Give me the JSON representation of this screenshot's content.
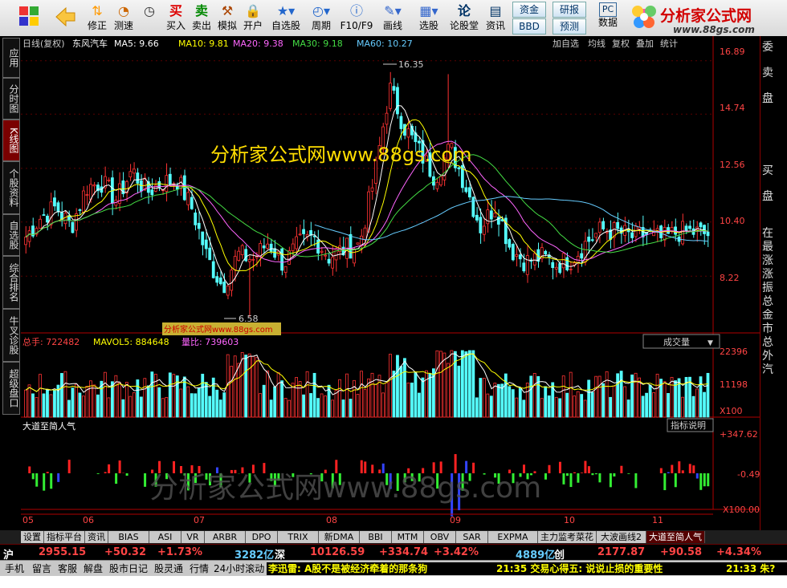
{
  "toolbar": {
    "buttons": [
      {
        "id": "fix",
        "label": "修正",
        "icon": "arrow-updown-icon"
      },
      {
        "id": "test",
        "label": "测速",
        "icon": "clock-icon"
      },
      {
        "id": "buy",
        "label": "买入",
        "icon": "buy-icon"
      },
      {
        "id": "sell",
        "label": "卖出",
        "icon": "sell-icon"
      },
      {
        "id": "sim",
        "label": "模拟",
        "icon": "hammer-icon"
      },
      {
        "id": "open",
        "label": "开户",
        "icon": "lock-icon"
      },
      {
        "id": "fav",
        "label": "自选股",
        "icon": "star-icon"
      },
      {
        "id": "period",
        "label": "周期",
        "icon": "clock-dropdown-icon"
      },
      {
        "id": "f10",
        "label": "F10/F9",
        "icon": "info-icon"
      },
      {
        "id": "draw",
        "label": "画线",
        "icon": "pen-icon"
      },
      {
        "id": "select",
        "label": "选股",
        "icon": "select-icon"
      },
      {
        "id": "forum",
        "label": "论股堂",
        "icon": "forum-icon"
      },
      {
        "id": "news",
        "label": "资讯",
        "icon": "news-icon"
      },
      {
        "id": "data",
        "label": "数据",
        "icon": "pc-icon"
      }
    ],
    "small": {
      "icon_a": "资",
      "icon_b": "研",
      "icon_c": "PC",
      "fund": "资金",
      "bbd": "BBD",
      "research": "研报",
      "forecast": "预测"
    },
    "logo": {
      "title": "分析家公式网",
      "url": "www.88gs.com"
    }
  },
  "leftnav": [
    "应用",
    "分时图",
    "K线图",
    "个股资料",
    "自选股",
    "综合排名",
    "牛叉诊股",
    "超级盘口"
  ],
  "main": {
    "period": "日线(复权)",
    "stock": "东风汽车",
    "ma": [
      {
        "label": "MA5: 9.66",
        "color": "#ffffff"
      },
      {
        "label": "MA10: 9.81",
        "color": "#ffff00"
      },
      {
        "label": "MA20: 9.38",
        "color": "#ff66ff"
      },
      {
        "label": "MA30: 9.18",
        "color": "#44dd44"
      },
      {
        "label": "MA60: 10.27",
        "color": "#66ccff"
      }
    ],
    "buttons": [
      "加自选",
      "均线",
      "复权",
      "叠加",
      "统计"
    ],
    "yticks": [
      "16.89",
      "14.74",
      "12.56",
      "10.40",
      "8.22"
    ],
    "high": "16.35",
    "low": "6.58",
    "watermark": "分析家公式网www.88gs.com",
    "watermark_small": "分析家公式网www.88gs.com"
  },
  "volume": {
    "total": "总手: 722482",
    "mavol": "MAVOL5: 884648",
    "ratio": "量比: 739603",
    "selector": "成交量",
    "yticks": [
      "22396",
      "11198",
      "X100"
    ]
  },
  "indicator": {
    "title": "大道至简人气",
    "button": "指标说明",
    "yticks": [
      "+347.62",
      "-0.49",
      "X100.00"
    ]
  },
  "xlabels": [
    "05",
    "06",
    "07",
    "08",
    "09",
    "10",
    "11"
  ],
  "bottom_watermark": "分析家公式网www.88gs.com",
  "right": [
    "委",
    "卖",
    "盘",
    "买",
    "盘",
    "在",
    "最",
    "涨",
    "涨",
    "振",
    "总",
    "金",
    "市",
    "总",
    "外",
    "汽"
  ],
  "tabs": [
    "设置",
    "指标平台",
    "资讯",
    "BIAS",
    "ASI",
    "VR",
    "ARBR",
    "DPO",
    "TRIX",
    "新DMA",
    "BBI",
    "MTM",
    "OBV",
    "SAR",
    "EXPMA",
    "主力监考菜花",
    "大波画线2",
    "大道至简人气"
  ],
  "quotes": [
    {
      "name": "沪",
      "value": "2955.15",
      "change": "+50.32",
      "pct": "+1.73%",
      "amount": "3282亿"
    },
    {
      "name": "深",
      "value": "10126.59",
      "change": "+334.74",
      "pct": "+3.42%",
      "amount": "4889亿"
    },
    {
      "name": "创",
      "value": "2177.87",
      "change": "+90.58",
      "pct": "+4.34%"
    }
  ],
  "status": {
    "items": [
      "手机",
      "留言",
      "客服",
      "解盘",
      "股市日记",
      "股灵通",
      "行情",
      "24小时滚动"
    ],
    "news1": "李迅雷: A股不是被经济牵着的那条狗",
    "news2": "21:35 交易心得五: 说说止损的重要性",
    "news3": "21:33 朱?"
  },
  "colors": {
    "up": "#ff3333",
    "down": "#55ffff",
    "axis": "#b00000"
  },
  "chart_data": {
    "type": "candlestick",
    "title": "东风汽车 日线(复权)",
    "x_months": [
      "05",
      "06",
      "07",
      "08",
      "09",
      "10",
      "11"
    ],
    "price_range": [
      6.0,
      17.3
    ],
    "high": 16.35,
    "low": 6.58,
    "close_path": [
      9.8,
      10.6,
      11.0,
      10.2,
      11.8,
      12.0,
      11.3,
      12.5,
      11.6,
      12.0,
      12.1,
      10.9,
      8.9,
      7.8,
      9.1,
      8.9,
      9.6,
      8.7,
      9.5,
      9.8,
      9.0,
      9.3,
      9.5,
      12.2,
      15.8,
      14.2,
      13.2,
      12.2,
      13.4,
      11.9,
      10.2,
      11.1,
      9.3,
      8.8,
      9.0,
      8.7,
      8.9,
      9.6,
      10.1,
      10.0,
      9.8,
      9.9,
      9.7,
      10.0,
      10.0,
      9.9
    ],
    "volume_range": [
      0,
      22396
    ],
    "indicator_range": [
      -300,
      347.62
    ]
  }
}
